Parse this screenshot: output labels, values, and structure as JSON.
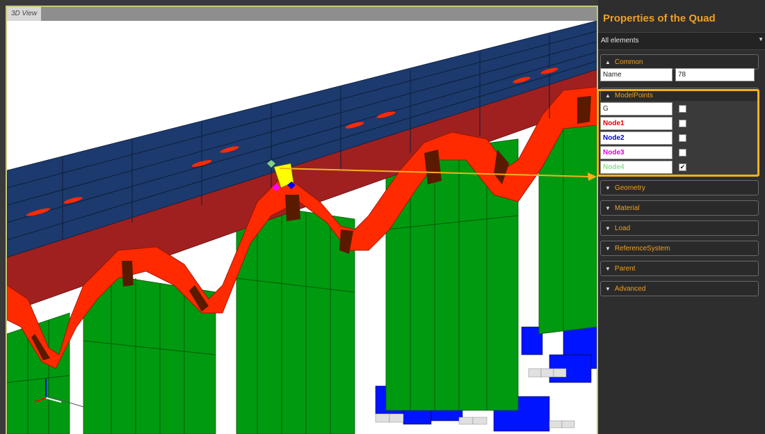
{
  "view": {
    "tab_label": "3D View"
  },
  "panel": {
    "title": "Properties of the Quad",
    "filter": "All elements",
    "common": {
      "header": "Common",
      "name_label": "Name",
      "name_value": "78"
    },
    "model_points": {
      "header": "ModelPoints",
      "rows": [
        {
          "label": "G",
          "color": "#333333",
          "checked": false
        },
        {
          "label": "Node1",
          "color": "#e00000",
          "checked": false
        },
        {
          "label": "Node2",
          "color": "#0000dd",
          "checked": false
        },
        {
          "label": "Node3",
          "color": "#e000e0",
          "checked": false
        },
        {
          "label": "Node4",
          "color": "#90e090",
          "checked": true
        }
      ]
    },
    "sections": [
      "Geometry",
      "Material",
      "Load",
      "ReferenceSystem",
      "Parent",
      "Advanced"
    ]
  },
  "colors": {
    "accent": "#f0a020",
    "roof_blue": "#1c3a6e",
    "arch_red": "#ff2a00",
    "wall_green": "#009a10",
    "base_blue": "#0014ff",
    "selected_quad": "#ffff00"
  }
}
